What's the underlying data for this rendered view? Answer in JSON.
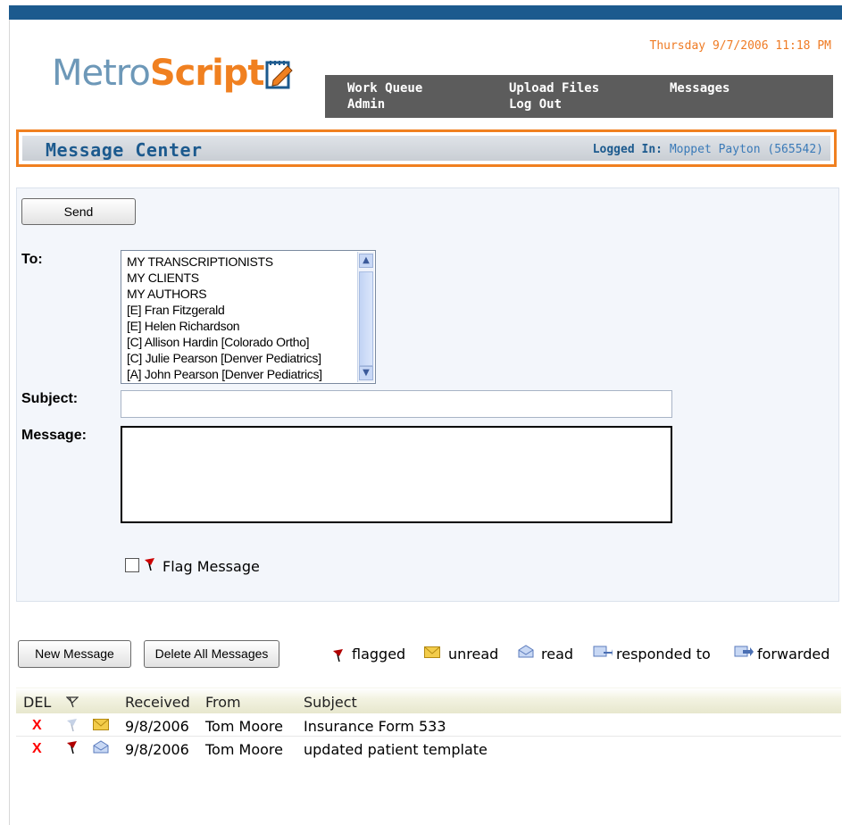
{
  "header": {
    "logo_part1": "Metro",
    "logo_part2": "Script",
    "datetime": "Thursday 9/7/2006 11:18 PM",
    "nav": [
      "Work Queue",
      "Upload Files",
      "Messages",
      "Admin",
      "Log Out"
    ]
  },
  "message_center": {
    "title": "Message Center",
    "logged_in_label": "Logged In:",
    "logged_in_user": "Moppet Payton (565542)"
  },
  "compose": {
    "send_label": "Send",
    "to_label": "To:",
    "recipients": [
      "MY TRANSCRIPTIONISTS",
      "MY CLIENTS",
      "MY AUTHORS",
      "[E] Fran Fitzgerald",
      "[E] Helen Richardson",
      "[C] Allison Hardin [Colorado Ortho]",
      "[C] Julie Pearson [Denver Pediatrics]",
      "[A] John Pearson [Denver Pediatrics]"
    ],
    "subject_label": "Subject:",
    "subject_value": "",
    "message_label": "Message:",
    "message_value": "",
    "flag_label": "Flag Message",
    "flag_checked": false
  },
  "actions": {
    "new_message": "New Message",
    "delete_all": "Delete All Messages"
  },
  "legend": {
    "flagged": "flagged",
    "unread": "unread",
    "read": "read",
    "responded": "responded to",
    "forwarded": "forwarded"
  },
  "table": {
    "headers": [
      "DEL",
      "Received",
      "From",
      "Subject"
    ],
    "rows": [
      {
        "del": "X",
        "flagged": false,
        "status": "unread",
        "received": "9/8/2006",
        "from": "Tom Moore",
        "subject": "Insurance Form 533"
      },
      {
        "del": "X",
        "flagged": true,
        "status": "read",
        "received": "9/8/2006",
        "from": "Tom Moore",
        "subject": "updated patient template"
      }
    ]
  },
  "colors": {
    "accent_orange": "#f08020",
    "brand_blue": "#1c5a8e",
    "nav_gray": "#5c5c5c",
    "delete_red": "#ff0000"
  }
}
